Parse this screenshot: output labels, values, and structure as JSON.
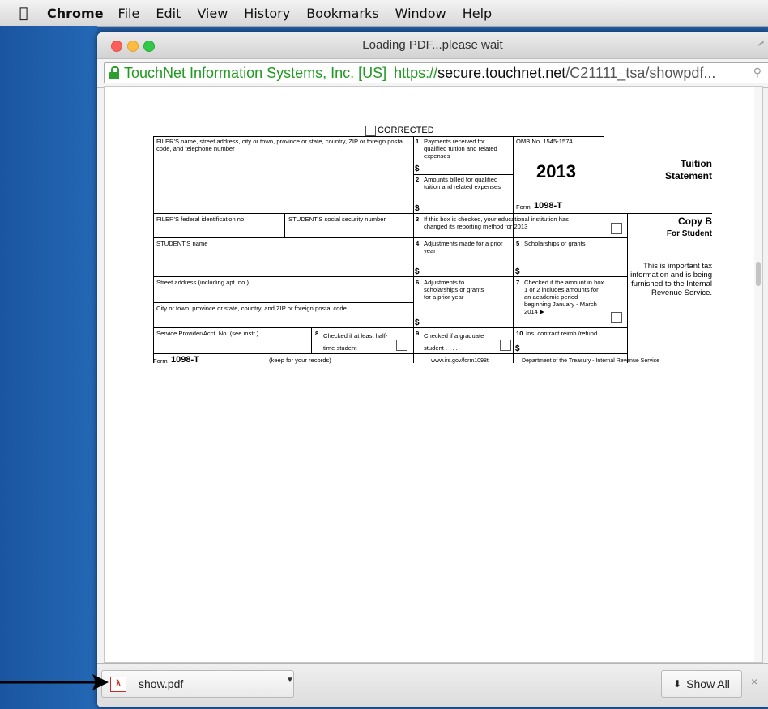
{
  "menubar": {
    "app": "Chrome",
    "items": [
      "File",
      "Edit",
      "View",
      "History",
      "Bookmarks",
      "Window",
      "Help"
    ]
  },
  "window": {
    "title": "Loading PDF...please wait"
  },
  "address": {
    "ev_org": "TouchNet Information Systems, Inc. [US]",
    "scheme": "https://",
    "host": "secure.touchnet.net",
    "path": "/C21111_tsa/showpdf..."
  },
  "form": {
    "corrected": "CORRECTED",
    "filer_name": "FILER'S name, street address, city or town, province or state, country, ZIP or foreign postal code, and telephone number",
    "box1": "Payments received for qualified tuition and related expenses",
    "box1_num": "1",
    "box2": "Amounts billed for qualified tuition and related expenses",
    "box2_num": "2",
    "dollar": "$",
    "omb": "OMB No. 1545-1574",
    "year": "2013",
    "form_label": "Form",
    "form_name": "1098-T",
    "tuition": "Tuition",
    "statement": "Statement",
    "filer_id": "FILER'S federal identification no.",
    "student_ssn": "STUDENT'S social security number",
    "box3": "If this box is checked, your educational institution has changed its reporting method for 2013",
    "box3_num": "3",
    "copy_b": "Copy B",
    "for_student": "For Student",
    "student_name": "STUDENT'S name",
    "box4": "Adjustments made for a prior year",
    "box4_num": "4",
    "box5": "Scholarships or grants",
    "box5_num": "5",
    "important": "This is important tax information and is being furnished to the Internal Revenue Service.",
    "street": "Street address (including apt. no.)",
    "box6": "Adjustments to scholarships or grants for a prior year",
    "box6_num": "6",
    "box7": "Checked if the amount in box 1 or 2 includes amounts for an academic period beginning January - March 2014 ▶",
    "box7_num": "7",
    "city": "City or town, province or state, country, and ZIP or foreign postal code",
    "service": "Service Provider/Acct. No. (see instr.)",
    "box8": "Checked if at least half-time student",
    "box8_num": "8",
    "box9": "Checked if a graduate student . . . .",
    "box9_num": "9",
    "box10": "Ins. contract reimb./refund",
    "box10_num": "10",
    "keep": "(keep for your records)",
    "website": "www.irs.gov/form1098t",
    "dept": "Department of the Treasury - Internal Revenue Service"
  },
  "download": {
    "filename": "show.pdf",
    "show_all": "Show All",
    "close": "×"
  }
}
